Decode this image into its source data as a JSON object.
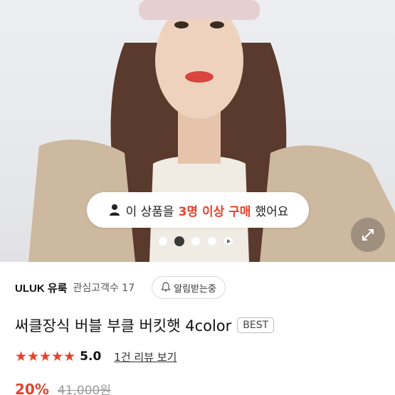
{
  "hero": {
    "purchase_notice": {
      "prefix": "이 상품을",
      "highlight": "3명 이상 구매",
      "suffix": "했어요"
    },
    "carousel": {
      "total": 5,
      "active_index": 1
    },
    "icons": {
      "notice": "person-icon",
      "expand": "expand-arrows-icon",
      "play": "play-icon"
    }
  },
  "brand": {
    "name": "ULUK 유룩",
    "follower_label": "관심고객수 17",
    "notify_label": "알림받는중",
    "notify_icon": "bell-icon"
  },
  "product": {
    "title": "써클장식 버블 부클 버킷햇 4color",
    "badge": "BEST"
  },
  "rating": {
    "stars": "★★★★★",
    "value": "5.0",
    "review_link": "1건 리뷰 보기",
    "star_color": "#e8412b"
  },
  "price": {
    "discount": "20%",
    "original": "41,000원",
    "accent_color": "#e8412b"
  }
}
